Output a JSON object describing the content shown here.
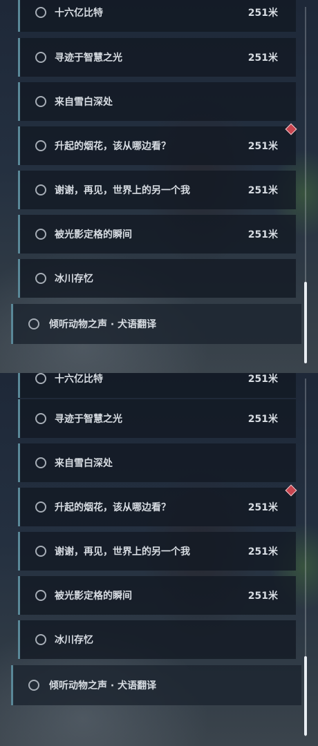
{
  "top": {
    "items": [
      {
        "label": "十六亿比特",
        "distance": "251米"
      },
      {
        "label": "寻迹于智慧之光",
        "distance": "251米"
      },
      {
        "label": "来自雪白深处",
        "distance": ""
      },
      {
        "label": "升起的烟花，该从哪边看？",
        "distance": "251米"
      },
      {
        "label": "谢谢，再见，世界上的另一个我",
        "distance": "251米"
      },
      {
        "label": "被光影定格的瞬间",
        "distance": "251米"
      },
      {
        "label": "冰川存忆",
        "distance": ""
      }
    ],
    "selected_item": {
      "label": "倾听动物之声 · 犬语翻译"
    }
  },
  "bottom": {
    "items": [
      {
        "label": "十六亿比特",
        "distance": "251米"
      },
      {
        "label": "寻迹于智慧之光",
        "distance": "251米"
      },
      {
        "label": "来自雪白深处",
        "distance": ""
      },
      {
        "label": "升起的烟花，该从哪边看？",
        "distance": "251米"
      },
      {
        "label": "谢谢，再见，世界上的另一个我",
        "distance": "251米"
      },
      {
        "label": "被光影定格的瞬间",
        "distance": "251米"
      },
      {
        "label": "冰川存忆",
        "distance": ""
      }
    ],
    "selected_item": {
      "label": "倾听动物之声 · 犬语翻译"
    }
  },
  "colors": {
    "accent_bar": "#5a8898",
    "marker": "#c8454f",
    "text": "#d7dce2"
  },
  "icons": {
    "radio": "radio-circle-icon",
    "marker": "diamond-marker-icon"
  }
}
